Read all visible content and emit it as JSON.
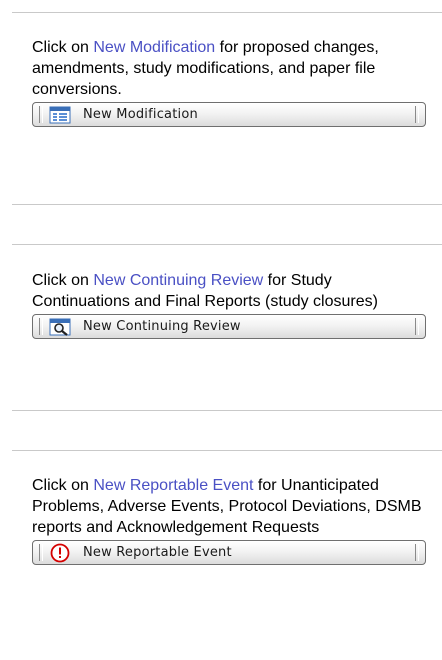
{
  "sections": [
    {
      "prefix": "Click on ",
      "link": "New Modification",
      "suffix": " for proposed changes, amendments, study modifications, and paper file conversions.",
      "button_label": "New Modification",
      "icon": "form-icon"
    },
    {
      "prefix": "Click on ",
      "link": "New Continuing Review",
      "suffix": " for Study Continuations and Final Reports (study closures)",
      "button_label": "New Continuing Review",
      "icon": "magnifier-icon"
    },
    {
      "prefix": "Click on ",
      "link": "New Reportable Event",
      "suffix": " for Unanticipated Problems, Adverse Events, Protocol Deviations, DSMB reports and Acknowledgement Requests",
      "button_label": "New Reportable Event",
      "icon": "alert-icon"
    }
  ],
  "colors": {
    "link": "#4a50c4",
    "divider": "#c9c9c9",
    "alert": "#d40000"
  }
}
